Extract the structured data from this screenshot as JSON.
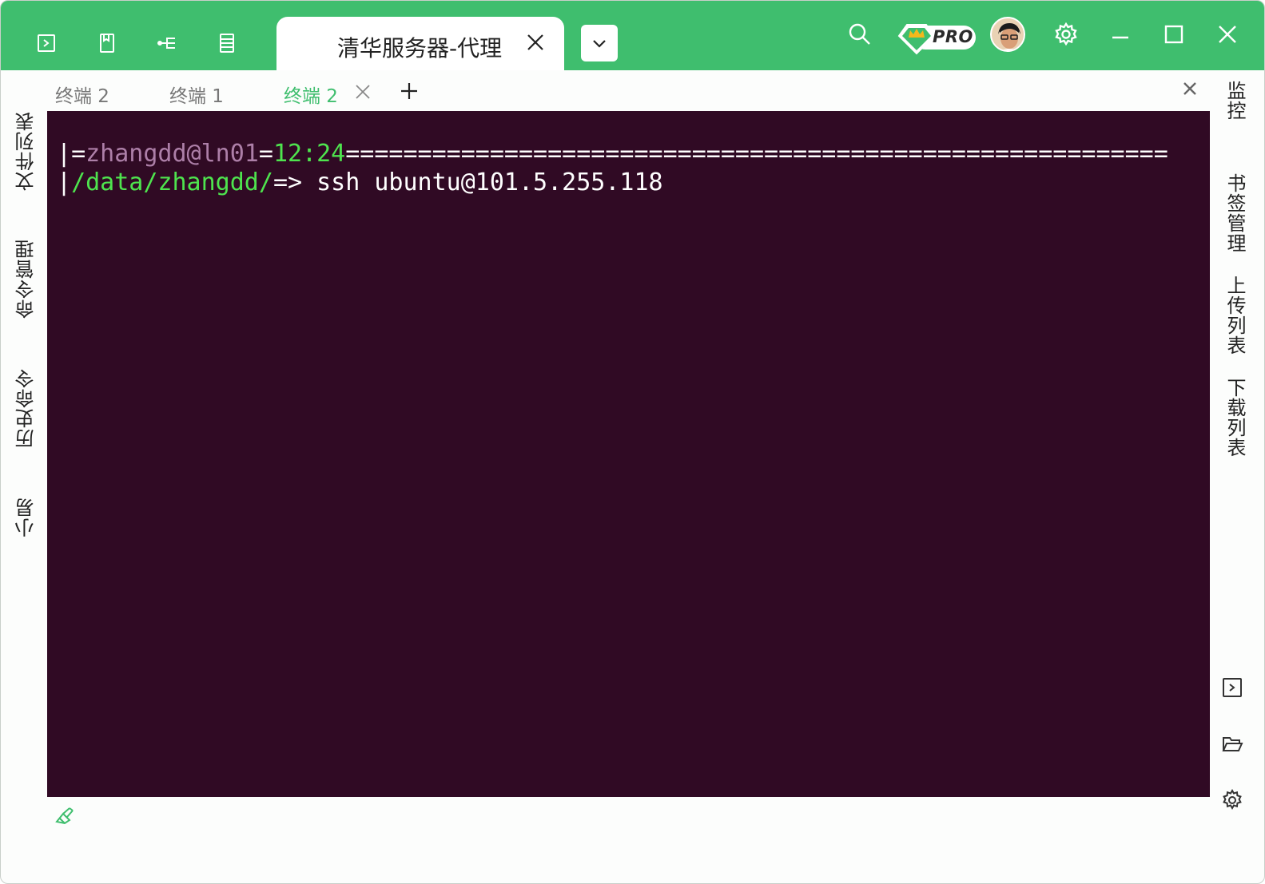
{
  "window": {
    "session_tab_title": "清华服务器-代理",
    "accent_color": "#3fbe6e",
    "terminal_bg": "#300a24"
  },
  "toolbar_left_icons": [
    "terminal-icon",
    "bookmark-icon",
    "tree-icon",
    "server-list-icon"
  ],
  "toolbar_right": {
    "search_icon": "search-icon",
    "pro_label": "PRO",
    "settings_icon": "gear-icon",
    "minimize_icon": "minimize-icon",
    "maximize_icon": "maximize-icon",
    "close_icon": "close-icon"
  },
  "subtabs": [
    {
      "label": "终端  2",
      "active": false
    },
    {
      "label": "终端  1",
      "active": false
    },
    {
      "label": "终端  2",
      "active": true
    }
  ],
  "left_sidebar": {
    "items": [
      "文件列表",
      "命令管理",
      "历史命令",
      "小易"
    ]
  },
  "right_sidebar": {
    "items": [
      "监控",
      "书签管理",
      "上传列表",
      "下载列表"
    ]
  },
  "terminal": {
    "line1": {
      "bar": "|",
      "eq1": "=",
      "user_host": "zhangdd@ln01",
      "eq2": "=",
      "time": "12:24",
      "fill": "========================================================="
    },
    "line2": {
      "bar": "|",
      "path": "/data/zhangdd/",
      "prompt": "=> ",
      "command": "ssh ubuntu@101.5.255.118"
    }
  }
}
